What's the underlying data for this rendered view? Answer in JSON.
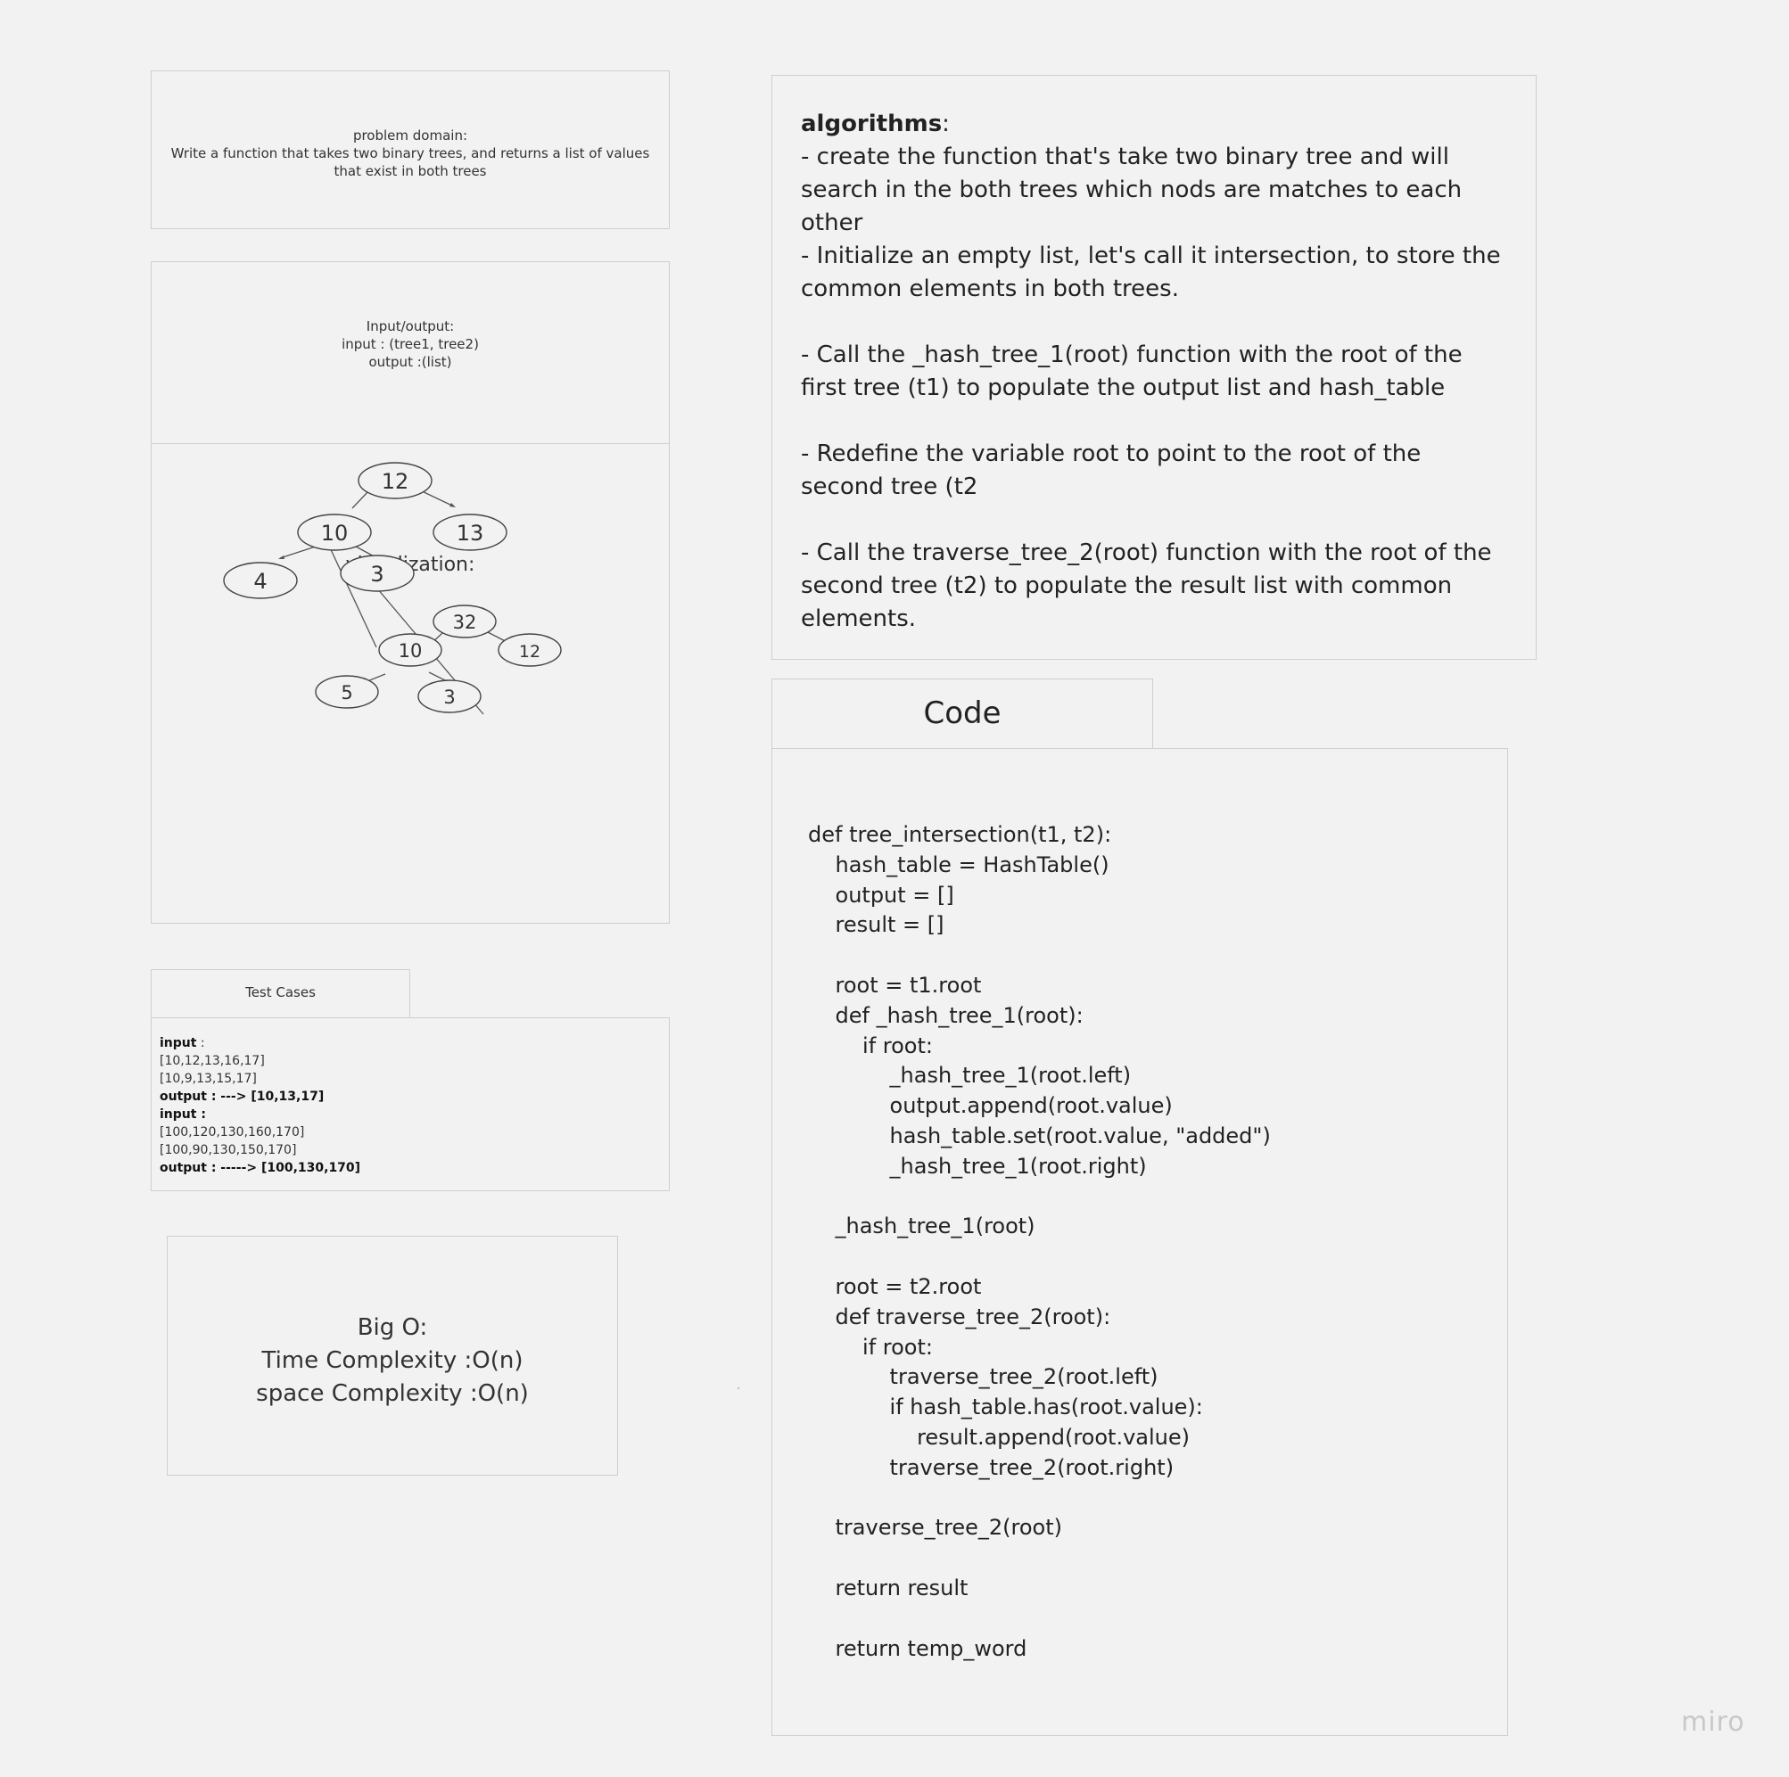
{
  "problem": {
    "heading": "problem domain:",
    "text": "Write a function that takes two binary trees, and returns a list of values that exist in both trees"
  },
  "io": {
    "heading": "Input/output:",
    "input": "input : (tree1, tree2)",
    "output": "output :(list)"
  },
  "visualization": {
    "title": "visualization:",
    "nodes": [
      "12",
      "10",
      "13",
      "4",
      "3",
      "32",
      "10",
      "12",
      "5",
      "3"
    ]
  },
  "test_cases": {
    "tab_label": "Test Cases",
    "input_label_1": "input",
    "input_suffix_1": " :",
    "case1_line1": "[10,12,13,16,17]",
    "case1_line2": "[10,9,13,15,17]",
    "output_1": "output : ---> [10,13,17]",
    "input_label_2": "input :",
    "case2_line1": "[100,120,130,160,170]",
    "case2_line2": "[100,90,130,150,170]",
    "output_2": "output : -----> [100,130,170]"
  },
  "big_o": {
    "heading": "Big O:",
    "time": "Time Complexity :O(n)",
    "space": "space Complexity :O(n)"
  },
  "algorithms": {
    "title": "algorithms",
    "colon": ":",
    "steps": [
      "- create the function that's take two binary tree and will search in the both trees which nods are matches to each other",
      "- Initialize an empty list, let's call it intersection, to store the common elements in both trees.",
      "- Call the _hash_tree_1(root) function with the root of the first tree (t1) to populate the output list and hash_table",
      "- Redefine the variable root to point to the root of the second tree (t2",
      "- Call the traverse_tree_2(root) function with the root of the second tree (t2) to populate the result list with common elements."
    ]
  },
  "code": {
    "tab_label": "Code",
    "source": "def tree_intersection(t1, t2):\n    hash_table = HashTable()\n    output = []\n    result = []\n\n    root = t1.root\n    def _hash_tree_1(root):\n        if root:\n            _hash_tree_1(root.left)\n            output.append(root.value)\n            hash_table.set(root.value, \"added\")\n            _hash_tree_1(root.right)\n\n    _hash_tree_1(root)\n\n    root = t2.root\n    def traverse_tree_2(root):\n        if root:\n            traverse_tree_2(root.left)\n            if hash_table.has(root.value):\n                result.append(root.value)\n            traverse_tree_2(root.right)\n\n    traverse_tree_2(root)\n\n    return result\n\n    return temp_word"
  },
  "brand": "miro"
}
